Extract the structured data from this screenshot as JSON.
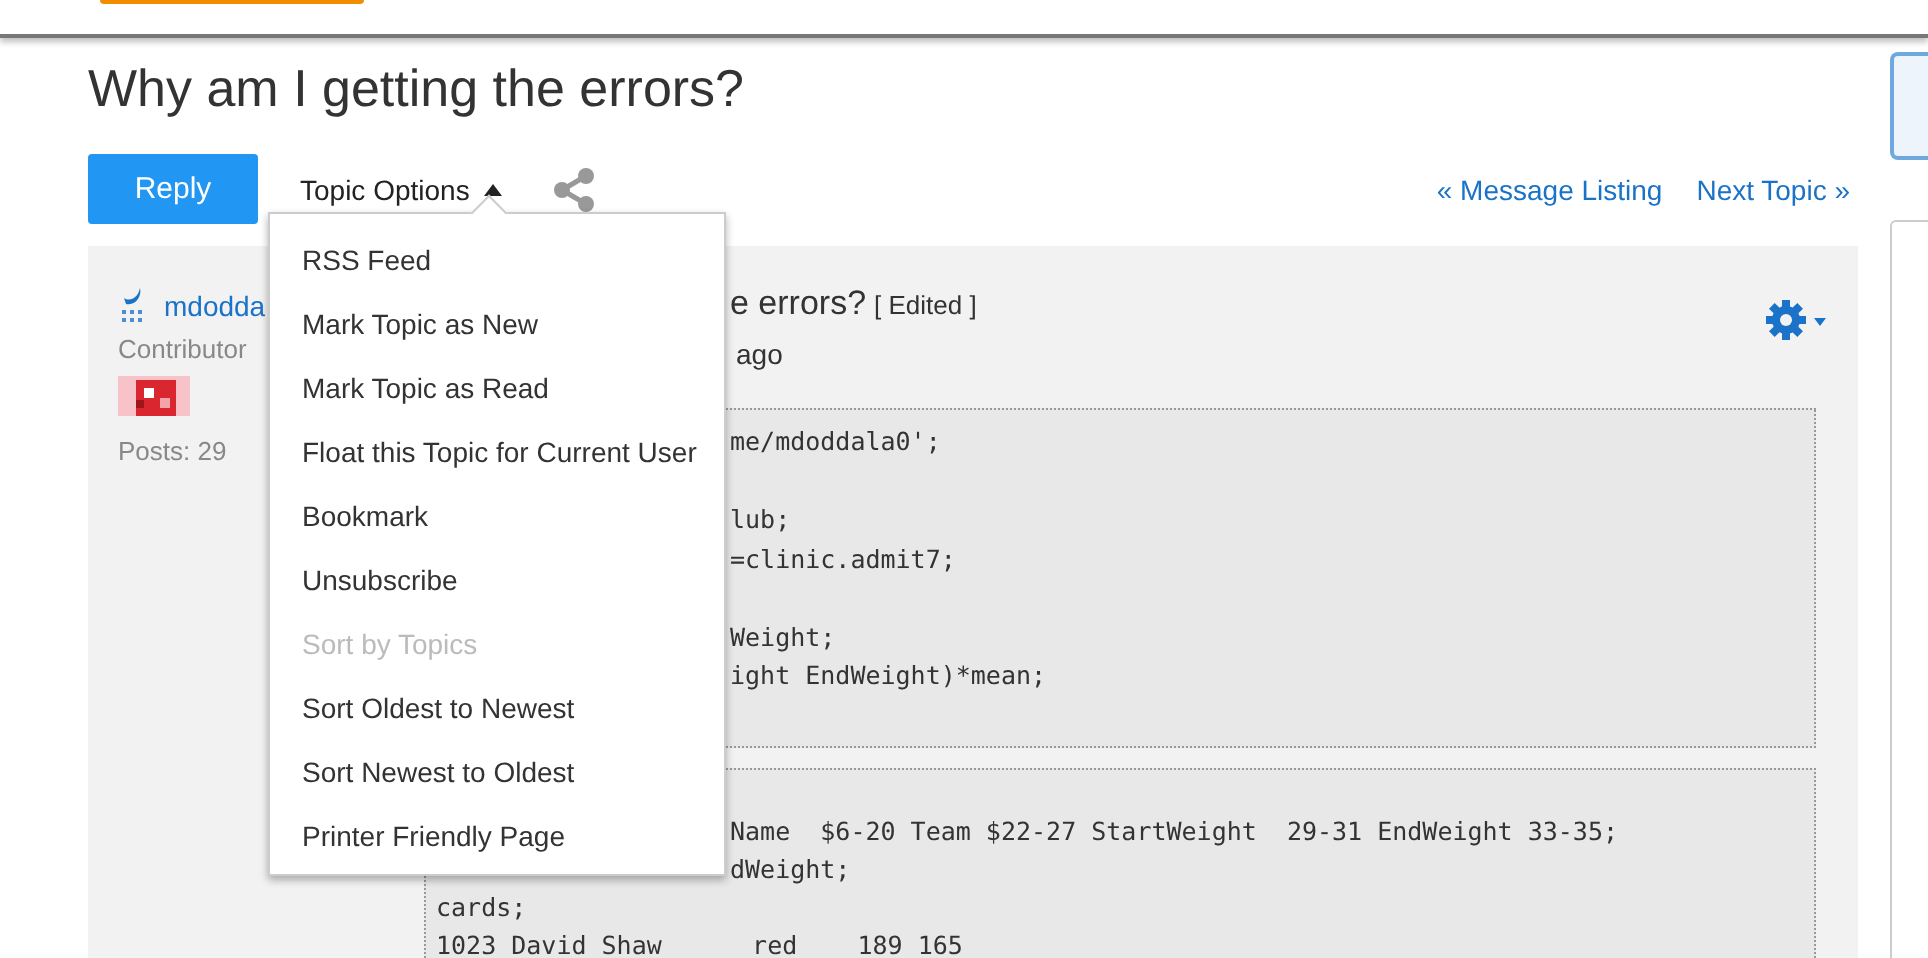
{
  "page_title": "Why am I getting the errors?",
  "actions": {
    "reply": "Reply",
    "topic_options": "Topic Options",
    "menu_open": true
  },
  "nav_links": [
    "« Message Listing",
    "Next Topic »"
  ],
  "post": {
    "author": "mdodda",
    "role": "Contributor",
    "posts": "Posts: 29",
    "title": "e errors?",
    "edited": "[ Edited ]",
    "time": "ago",
    "code_blocks": [
      {
        "lines": [
          {
            "kind": "covered",
            "text": "me/mdoddala0';"
          },
          {
            "kind": "blank"
          },
          {
            "kind": "covered",
            "text": "lub;"
          },
          {
            "kind": "covered",
            "text": "=clinic.admit7;"
          },
          {
            "kind": "blank"
          },
          {
            "kind": "covered",
            "text": "Weight;"
          },
          {
            "kind": "covered",
            "text": "ight EndWeight)*mean;"
          },
          {
            "kind": "blank"
          }
        ]
      },
      {
        "lines": [
          {
            "kind": "blank"
          },
          {
            "kind": "covered",
            "text": "Name  $6-20 Team $22-27 StartWeight  29-31 EndWeight 33-35;"
          },
          {
            "kind": "covered",
            "text": "dWeight;"
          },
          {
            "kind": "code",
            "text": "cards;"
          },
          {
            "kind": "code",
            "text": "1023 David Shaw      red    189 165"
          }
        ]
      }
    ]
  },
  "menu": [
    {
      "label": "RSS Feed",
      "disabled": false
    },
    {
      "label": "Mark Topic as New",
      "disabled": false
    },
    {
      "label": "Mark Topic as Read",
      "disabled": false
    },
    {
      "label": "Float this Topic for Current User",
      "disabled": false
    },
    {
      "label": "Bookmark",
      "disabled": false
    },
    {
      "label": "Unsubscribe",
      "disabled": false
    },
    {
      "label": "Sort by Topics",
      "disabled": true
    },
    {
      "label": "Sort Oldest to Newest",
      "disabled": false
    },
    {
      "label": "Sort Newest to Oldest",
      "disabled": false
    },
    {
      "label": "Printer Friendly Page",
      "disabled": false
    }
  ]
}
